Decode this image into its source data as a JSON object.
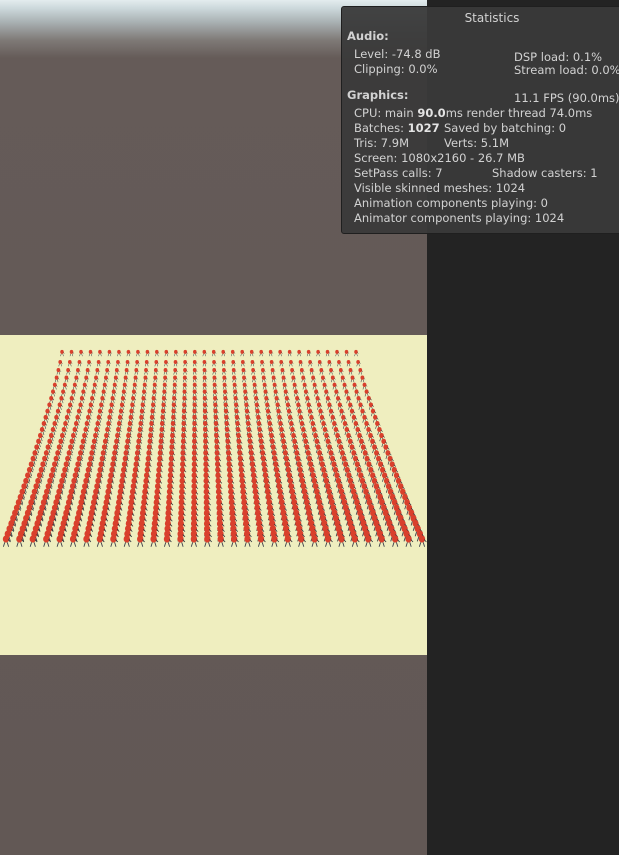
{
  "stats": {
    "title": "Statistics",
    "audio": {
      "heading": "Audio:",
      "level": "Level: -74.8 dB",
      "clipping": "Clipping: 0.0%",
      "dsp_load": "DSP load: 0.1%",
      "stream_load": "Stream load: 0.0%"
    },
    "graphics": {
      "heading": "Graphics:",
      "fps": "11.1 FPS (90.0ms)",
      "cpu_prefix": "CPU: main ",
      "cpu_main": "90.0",
      "cpu_suffix": "ms  render thread 74.0ms",
      "batches_prefix": "Batches: ",
      "batches": "1027",
      "saved_by_batching": "Saved by batching: 0",
      "tris": "Tris: 7.9M",
      "verts": "Verts: 5.1M",
      "screen": "Screen: 1080x2160 - 26.7 MB",
      "setpass": "SetPass calls: 7",
      "shadow_casters": "Shadow casters: 1",
      "visible_skinned": "Visible skinned meshes: 1024",
      "animation_components": "Animation components playing: 0",
      "animator_components": "Animator components playing: 1024"
    }
  },
  "scene": {
    "crowd_rows": 32,
    "crowd_cols": 32,
    "ground_color": "#efeebf",
    "character_color": "#d9402c"
  }
}
